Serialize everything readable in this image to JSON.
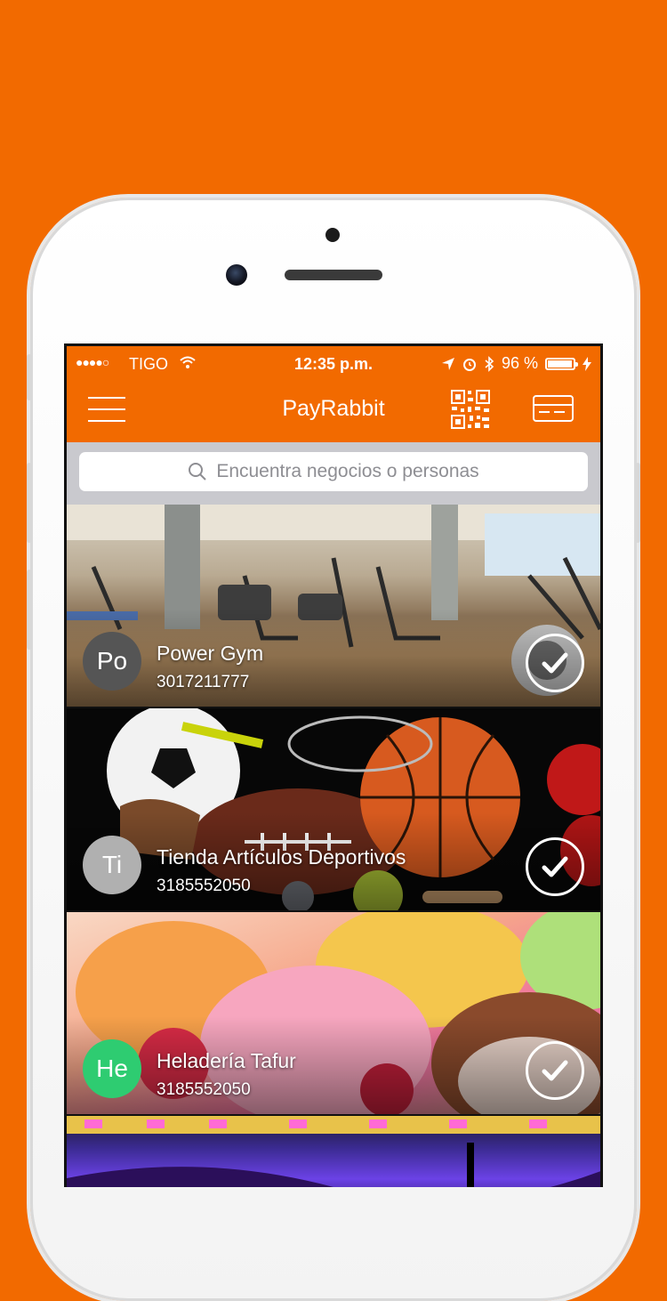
{
  "status_bar": {
    "signal": "●●●●○",
    "carrier": "TIGO",
    "time": "12:35 p.m.",
    "battery": "96 %"
  },
  "navbar": {
    "title": "PayRabbit",
    "menu_icon": "hamburger-icon",
    "qr_icon": "qr-code-icon",
    "card_icon": "credit-card-icon"
  },
  "search": {
    "placeholder": "Encuentra negocios o personas"
  },
  "businesses": [
    {
      "initials": "Po",
      "name": "Power Gym",
      "phone": "3017211777",
      "avatar_color": "#555555"
    },
    {
      "initials": "Ti",
      "name": "Tienda Artículos Deportivos",
      "phone": "3185552050",
      "avatar_color": "#b0b0b0"
    },
    {
      "initials": "He",
      "name": "Heladería Tafur",
      "phone": "3185552050",
      "avatar_color": "#2ecc71"
    }
  ],
  "colors": {
    "brand": "#F26A00",
    "search_bg": "#c9c9ce"
  }
}
